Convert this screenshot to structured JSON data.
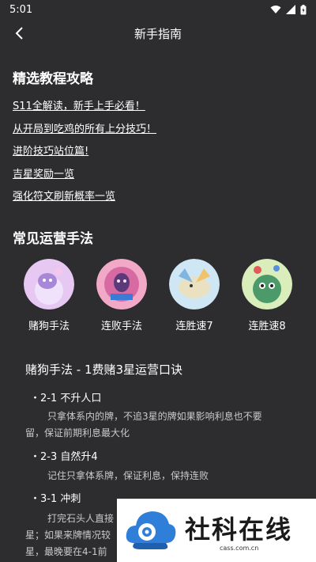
{
  "status": {
    "time": "5:01"
  },
  "nav": {
    "title": "新手指南"
  },
  "section1": {
    "title": "精选教程攻略",
    "links": [
      "S11全解读，新手上手必看！",
      "从开局到吃鸡的所有上分技巧！",
      "进阶技巧站位篇!",
      "吉星奖励一览",
      "强化符文刷新概率一览"
    ]
  },
  "section2": {
    "title": "常见运营手法",
    "items": [
      {
        "label": "赌狗手法"
      },
      {
        "label": "连败手法"
      },
      {
        "label": "连胜速7"
      },
      {
        "label": "连胜速8"
      }
    ]
  },
  "detail": {
    "title": "赌狗手法 - 1费赌3星运营口诀",
    "bullets": [
      {
        "label": "・2-1   不升人口",
        "desc_line1": "只拿体系内的牌，不追3星的牌如果影响利息也不要",
        "desc_line2": "留，保证前期利息最大化"
      },
      {
        "label": "・2-3   自然升4",
        "desc_line1": "记住只拿体系牌，保证利息，保持连败",
        "desc_line2": ""
      },
      {
        "label": "・3-1   冲刺",
        "desc_line1": "打完石头人直接",
        "desc_line2": "星；如果来牌情况较",
        "desc_line3": "星，最晚要在4-1前"
      }
    ]
  },
  "watermark": {
    "brand": "社科在线",
    "url": "cass.com.cn"
  },
  "colors": {
    "background": "#2d2d2f",
    "text": "#ffffff",
    "muted": "#c9c9cc",
    "watermark_blue": "#2f7fd8"
  }
}
